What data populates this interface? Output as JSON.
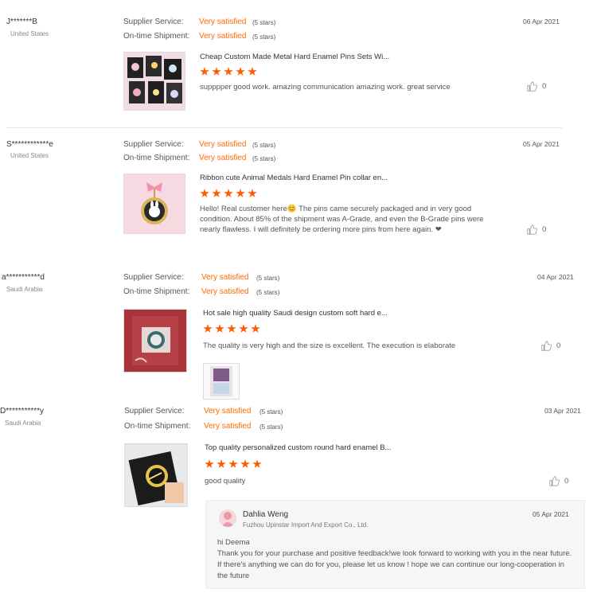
{
  "reviews": [
    {
      "user": "J*******B",
      "country": "United States",
      "date": "06 Apr 2021",
      "supplier_label": "Supplier Service:",
      "supplier_value": "Very satisfied",
      "supplier_stars": "(5 stars)",
      "shipment_label": "On-time Shipment:",
      "shipment_value": "Very satisfied",
      "shipment_stars": "(5 stars)",
      "product": "Cheap Custom Made Metal Hard Enamel Pins Sets Wi...",
      "rating": 5,
      "comment": "supppper good work. amazing communication amazing work. great service",
      "likes": "0"
    },
    {
      "user": "S************e",
      "country": "United States",
      "date": "05 Apr 2021",
      "supplier_label": "Supplier Service:",
      "supplier_value": "Very satisfied",
      "supplier_stars": "(5 stars)",
      "shipment_label": "On-time Shipment:",
      "shipment_value": "Very satisfied",
      "shipment_stars": "(5 stars)",
      "product": "Ribbon cute Animal Medals Hard Enamel Pin collar en...",
      "rating": 5,
      "comment": "Hello! Real customer here😊 The pins came securely packaged and in very good condition. About 85% of the shipment was A-Grade, and even the B-Grade pins were nearly flawless. I will definitely be ordering more pins from here again. ❤",
      "likes": "0"
    },
    {
      "user": "a***********d",
      "country": "Saudi Arabia",
      "date": "04 Apr 2021",
      "supplier_label": "Supplier Service:",
      "supplier_value": "Very satisfied",
      "supplier_stars": "(5 stars)",
      "shipment_label": "On-time Shipment:",
      "shipment_value": "Very satisfied",
      "shipment_stars": "(5 stars)",
      "product": "Hot sale high quality Saudi design custom soft hard e...",
      "rating": 5,
      "comment": "The quality is very high and the size is excellent. The execution is elaborate",
      "likes": "0"
    },
    {
      "user": "D***********y",
      "country": "Saudi Arabia",
      "date": "03 Apr 2021",
      "supplier_label": "Supplier Service:",
      "supplier_value": "Very satisfied",
      "supplier_stars": "(5 stars)",
      "shipment_label": "On-time Shipment:",
      "shipment_value": "Very satisfied",
      "shipment_stars": "(5 stars)",
      "product": "Top quality personalized custom round hard enamel B...",
      "rating": 5,
      "comment": "good quality",
      "likes": "0",
      "reply": {
        "name": "Dahlia Weng",
        "company": "Fuzhou Upinstar Import And Export Co., Ltd.",
        "date": "05 Apr 2021",
        "greeting": "hi Deema",
        "text": "Thank you for your purchase and positive feedback!we look forward to working with you in the near future. If there's anything we can do for you, please let us know ! hope we can continue our long-cooperation in the future"
      }
    }
  ],
  "colors": {
    "accent": "#ff6a00",
    "star": "#ff5a00"
  },
  "icons": {
    "like": "thumbs-up-icon",
    "star": "star-icon"
  }
}
